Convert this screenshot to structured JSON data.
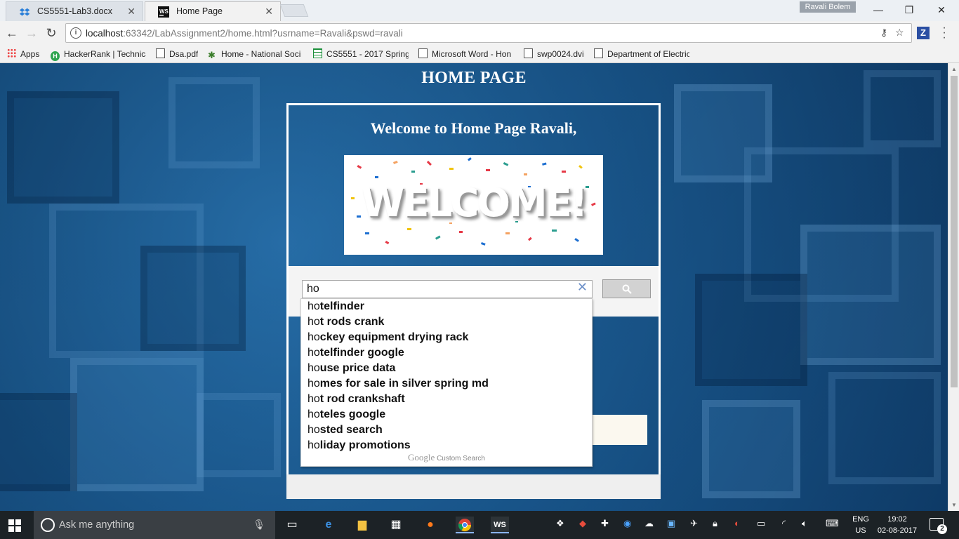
{
  "browser": {
    "tabs": [
      {
        "title": "CS5551-Lab3.docx",
        "icon": "dropbox-icon",
        "active": false
      },
      {
        "title": "Home Page",
        "icon": "webstorm-icon",
        "active": true
      }
    ],
    "profile_name": "Ravali Bolem",
    "url": {
      "host": "localhost",
      "rest": ":63342/LabAssignment2/home.html?usrname=Ravali&pswd=ravali"
    },
    "bookmarks": [
      {
        "label": "Apps",
        "icon": "apps-grid-icon"
      },
      {
        "label": "HackerRank | Technica",
        "icon": "hackerrank-icon"
      },
      {
        "label": "Dsa.pdf",
        "icon": "document-icon"
      },
      {
        "label": "Home - National Soci",
        "icon": "figure-icon"
      },
      {
        "label": "CS5551 - 2017 Spring",
        "icon": "sheets-icon"
      },
      {
        "label": "Microsoft Word - Hon",
        "icon": "document-icon"
      },
      {
        "label": "swp0024.dvi",
        "icon": "document-icon"
      },
      {
        "label": "Department of Electric",
        "icon": "document-icon"
      }
    ]
  },
  "page": {
    "title": "HOME PAGE",
    "welcome_text": "Welcome to Home Page Ravali,",
    "welcome_image_word": "WELCOME!",
    "search": {
      "query": "ho",
      "suggestions": [
        {
          "typed": "ho",
          "rest": "telfinder"
        },
        {
          "typed": "ho",
          "rest": "t rods crank"
        },
        {
          "typed": "ho",
          "rest": "ckey equipment drying rack"
        },
        {
          "typed": "ho",
          "rest": "telfinder google"
        },
        {
          "typed": "ho",
          "rest": "use price data"
        },
        {
          "typed": "ho",
          "rest": "mes for sale in silver spring md"
        },
        {
          "typed": "ho",
          "rest": "t rod crankshaft"
        },
        {
          "typed": "ho",
          "rest": "teles google"
        },
        {
          "typed": "ho",
          "rest": "sted search"
        },
        {
          "typed": "ho",
          "rest": "liday promotions"
        }
      ],
      "footer_brand": "Google",
      "footer_label": "Custom Search"
    }
  },
  "taskbar": {
    "search_placeholder": "Ask me anything",
    "language_line1": "ENG",
    "language_line2": "US",
    "time": "19:02",
    "date": "02-08-2017",
    "notification_count": "2"
  },
  "colors": {
    "page_background": "#1a5a92",
    "taskbar": "#1c2226",
    "bookmark_bar": "#f2f2f2"
  }
}
